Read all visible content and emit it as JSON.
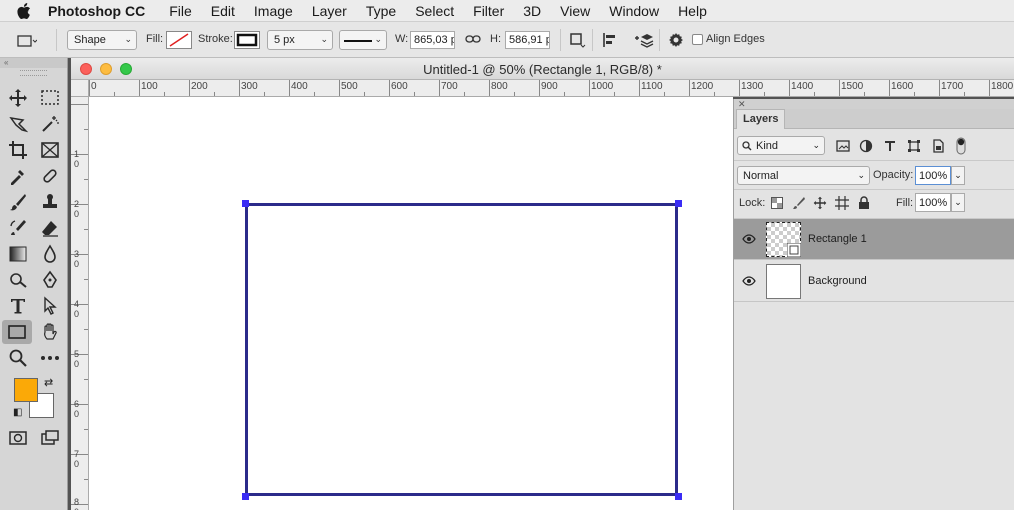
{
  "menubar": {
    "apple_icon": "apple-icon",
    "items": [
      "Photoshop CC",
      "File",
      "Edit",
      "Image",
      "Layer",
      "Type",
      "Select",
      "Filter",
      "3D",
      "View",
      "Window",
      "Help"
    ]
  },
  "options": {
    "tool_mode": "Shape",
    "fill_label": "Fill:",
    "stroke_label": "Stroke:",
    "stroke_width": "5 px",
    "w_label": "W:",
    "w_value": "865,03 p",
    "h_label": "H:",
    "h_value": "586,91 p",
    "align_edges": "Align Edges",
    "icons": [
      "rectangle-tool-icon",
      "link-icon",
      "path-operations-icon",
      "path-alignment-icon",
      "path-arrangement-icon",
      "gear-icon"
    ]
  },
  "document": {
    "title": "Untitled-1 @ 50% (Rectangle 1, RGB/8) *",
    "ruler_h": [
      "0",
      "100",
      "200",
      "300",
      "400",
      "500",
      "600",
      "700",
      "800",
      "900",
      "1000",
      "1100",
      "1200",
      "1300",
      "1400",
      "1500",
      "1600",
      "1700",
      "1800"
    ],
    "ruler_v": [
      "1",
      "2",
      "3",
      "4",
      "5",
      "6",
      "7",
      "8"
    ],
    "ruler_v_sub": [
      "0",
      "0",
      "0",
      "0",
      "0",
      "0",
      "0",
      "0"
    ]
  },
  "tools": {
    "icons": [
      "move-tool-icon",
      "marquee-tool-icon",
      "lasso-tool-icon",
      "magic-wand-icon",
      "crop-tool-icon",
      "frame-tool-icon",
      "eyedropper-icon",
      "healing-brush-icon",
      "brush-tool-icon",
      "clone-stamp-icon",
      "history-brush-icon",
      "eraser-icon",
      "gradient-tool-icon",
      "blur-tool-icon",
      "dodge-tool-icon",
      "pen-tool-icon",
      "type-tool-icon",
      "path-selection-icon",
      "rectangle-tool-icon",
      "hand-tool-icon",
      "zoom-tool-icon",
      "more-tools-icon",
      "quick-mask-icon",
      "screen-mode-icon"
    ],
    "foreground_color": "#fba907",
    "background_color": "#ffffff"
  },
  "layers": {
    "tab": "Layers",
    "filter_kind": "Kind",
    "blend_mode": "Normal",
    "opacity_label": "Opacity:",
    "opacity": "100%",
    "lock_label": "Lock:",
    "fill_label": "Fill:",
    "fill": "100%",
    "items": [
      {
        "name": "Rectangle 1",
        "visible": true,
        "selected": true
      },
      {
        "name": "Background",
        "visible": true,
        "selected": false
      }
    ]
  },
  "colors": {
    "shape_stroke": "#2b2a8a",
    "handle": "#3a2cf5",
    "close_light": "#fc605b",
    "min_light": "#fdbc40",
    "max_light": "#34c84a"
  }
}
